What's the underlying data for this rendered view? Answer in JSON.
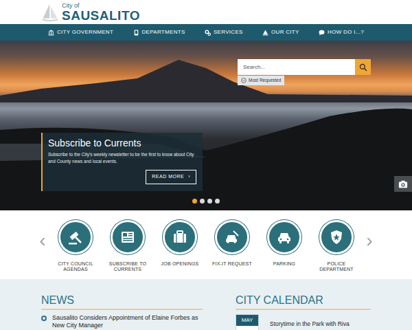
{
  "header": {
    "logo_small": "City of",
    "logo_big": "SAUSALITO"
  },
  "nav": {
    "items": [
      {
        "label": "CITY GOVERNMENT"
      },
      {
        "label": "DEPARTMENTS"
      },
      {
        "label": "SERVICES"
      },
      {
        "label": "OUR CITY"
      },
      {
        "label": "HOW DO I...?"
      }
    ]
  },
  "search": {
    "placeholder": "Search...",
    "most_requested": "Most Requested"
  },
  "slide": {
    "title": "Subscribe to Currents",
    "text": "Subscribe to the City's weekly newsletter to be the first to know about City and County news and local events.",
    "button": "READ MORE",
    "button_chevron": "›"
  },
  "slider_dots": [
    {
      "selected": true
    },
    {
      "selected": false
    },
    {
      "selected": false
    },
    {
      "selected": false
    }
  ],
  "quick_links": {
    "prev": "‹",
    "next": "›",
    "items": [
      {
        "label": "CITY COUNCIL AGENDAS"
      },
      {
        "label": "SUBSCRIBE TO CURRENTS"
      },
      {
        "label": "JOB OPENINGS"
      },
      {
        "label": "FIX-IT REQUEST"
      },
      {
        "label": "PARKING"
      },
      {
        "label": "POLICE DEPARTMENT"
      }
    ]
  },
  "news": {
    "heading": "NEWS",
    "items": [
      {
        "title": "Sausalito Considers Appointment of Elaine Forbes as New City Manager"
      }
    ]
  },
  "calendar": {
    "heading": "CITY CALENDAR",
    "events": [
      {
        "month": "MAY",
        "title": "Storytime in the Park with Riva"
      }
    ]
  }
}
